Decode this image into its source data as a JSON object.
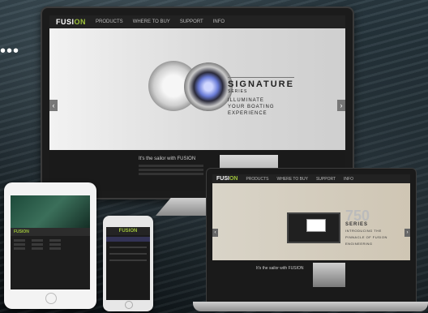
{
  "brand": {
    "name_prefix": "FUSI",
    "name_suffix": "ON"
  },
  "monitor": {
    "nav": [
      "PRODUCTS",
      "WHERE TO BUY",
      "SUPPORT",
      "INFO"
    ],
    "hero": {
      "title": "SIGNATURE",
      "subtitle": "SERIES",
      "tagline_line1": "ILLUMINATE",
      "tagline_line2": "YOUR BOATING",
      "tagline_line3": "EXPERIENCE"
    },
    "lower_caption": "It's the sailor with FUSION",
    "arrows": {
      "left": "‹",
      "right": "›"
    }
  },
  "laptop": {
    "nav": [
      "PRODUCTS",
      "WHERE TO BUY",
      "SUPPORT",
      "INFO"
    ],
    "hero": {
      "number": "750",
      "series": "SERIES",
      "intro1": "INTRODUCING THE",
      "intro2": "PINNACLE OF FUSION",
      "intro3": "ENGINEERING"
    },
    "lower_caption": "It's the sailor with FUSION",
    "arrows": {
      "left": "‹",
      "right": "›"
    }
  },
  "tablet": {
    "logo": "FUSION"
  },
  "phone": {
    "logo": "FUSION"
  },
  "misc": {
    "dots": "•••"
  }
}
